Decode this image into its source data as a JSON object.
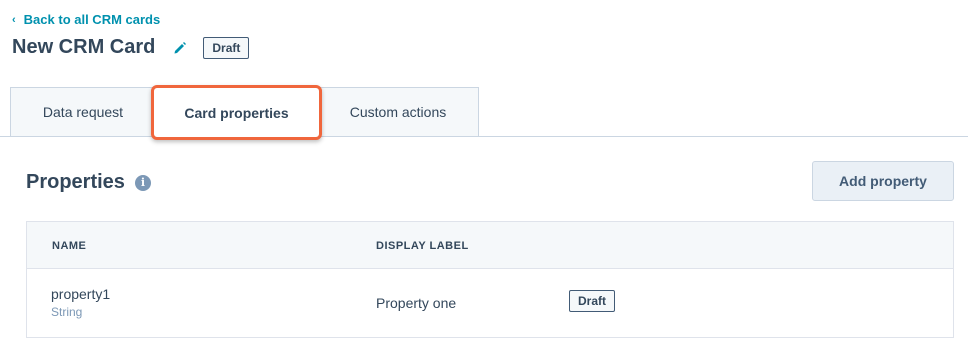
{
  "nav": {
    "back_label": "Back to all CRM cards"
  },
  "header": {
    "title": "New CRM Card",
    "status_badge": "Draft"
  },
  "tabs": [
    {
      "label": "Data request",
      "selected": false
    },
    {
      "label": "Card properties",
      "selected": true
    },
    {
      "label": "Custom actions",
      "selected": false
    }
  ],
  "properties": {
    "title": "Properties",
    "add_button": "Add property",
    "columns": {
      "name": "NAME",
      "display_label": "DISPLAY LABEL"
    },
    "rows": [
      {
        "name": "property1",
        "type": "String",
        "display_label": "Property one",
        "status": "Draft"
      }
    ]
  },
  "colors": {
    "link": "#0091ae",
    "text": "#33475b",
    "highlight": "#f0663c"
  },
  "icons": {
    "back": "chevron-left-icon",
    "edit": "pencil-icon",
    "info": "info-icon"
  }
}
